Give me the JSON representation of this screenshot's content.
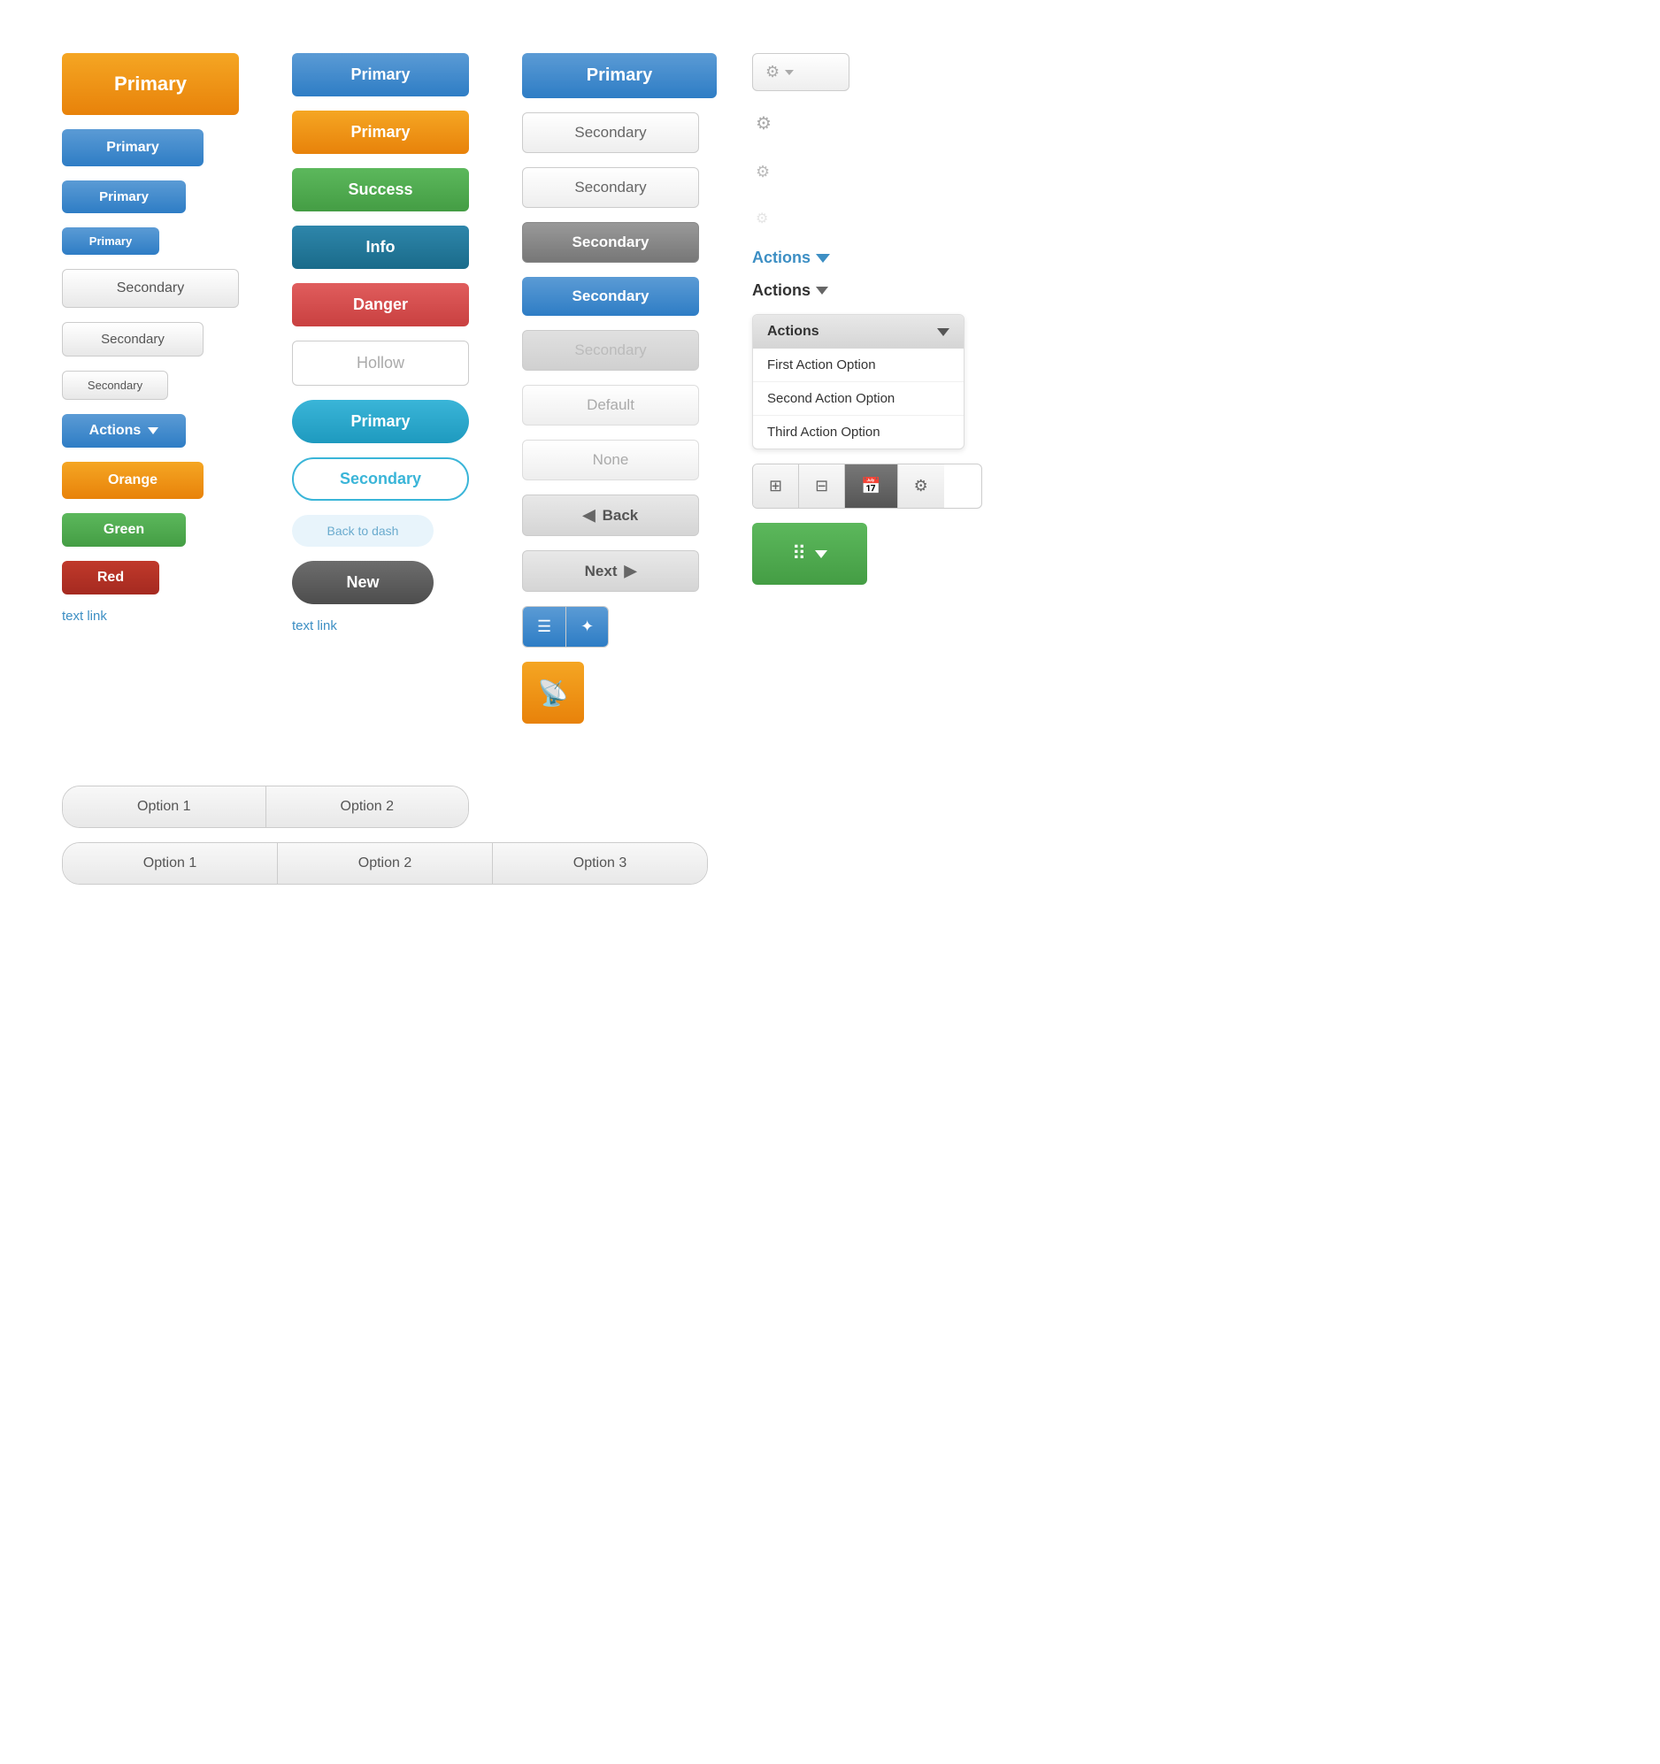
{
  "col1": {
    "buttons": [
      {
        "label": "Primary",
        "type": "primary-orange-lg"
      },
      {
        "label": "Primary",
        "type": "primary-blue"
      },
      {
        "label": "Primary",
        "type": "primary-blue-sm"
      },
      {
        "label": "Primary",
        "type": "primary-blue-xs"
      },
      {
        "label": "Secondary",
        "type": "secondary-lg"
      },
      {
        "label": "Secondary",
        "type": "secondary-md"
      },
      {
        "label": "Secondary",
        "type": "secondary-sm"
      },
      {
        "label": "Actions",
        "type": "actions-blue"
      },
      {
        "label": "Orange",
        "type": "orange"
      },
      {
        "label": "Green",
        "type": "green"
      },
      {
        "label": "Red",
        "type": "red"
      }
    ],
    "textLink": "text link"
  },
  "col2": {
    "buttons": [
      {
        "label": "Primary",
        "type": "col2-primary-blue"
      },
      {
        "label": "Primary",
        "type": "col2-primary-orange"
      },
      {
        "label": "Success",
        "type": "col2-success"
      },
      {
        "label": "Info",
        "type": "col2-info"
      },
      {
        "label": "Danger",
        "type": "col2-danger"
      },
      {
        "label": "Hollow",
        "type": "col2-hollow"
      },
      {
        "label": "Primary",
        "type": "col2-primary-pill"
      },
      {
        "label": "Secondary",
        "type": "col2-secondary-pill"
      },
      {
        "label": "Back to dash",
        "type": "col2-light-pill"
      },
      {
        "label": "New",
        "type": "col2-dark-pill"
      }
    ],
    "textLink": "text link"
  },
  "col3": {
    "buttons": [
      {
        "label": "Primary",
        "type": "col3-primary-blue"
      },
      {
        "label": "Secondary",
        "type": "col3-secondary"
      },
      {
        "label": "Secondary",
        "type": "col3-secondary-flat"
      },
      {
        "label": "Secondary",
        "type": "col3-secondary-dark"
      },
      {
        "label": "Secondary",
        "type": "col3-secondary-blue"
      },
      {
        "label": "Secondary",
        "type": "col3-secondary-disabled"
      },
      {
        "label": "Default",
        "type": "col3-default"
      },
      {
        "label": "None",
        "type": "col3-none"
      },
      {
        "label": "Back",
        "type": "col3-back"
      },
      {
        "label": "Next",
        "type": "col3-next"
      }
    ],
    "iconButtons": [
      "≡",
      "⋙"
    ],
    "rssLabel": "RSS"
  },
  "col4": {
    "gearButtons": [
      {
        "type": "gear-with-border"
      },
      {
        "type": "gear-plain-1"
      },
      {
        "type": "gear-plain-2"
      },
      {
        "type": "gear-plain-disabled"
      }
    ],
    "actionsBlueLabel": "Actions",
    "actionsDarkLabel": "Actions",
    "dropdown": {
      "headerLabel": "Actions",
      "items": [
        "First Action Option",
        "Second Action Option",
        "Third Action Option"
      ]
    },
    "toolbarButtons": [
      "grid",
      "columns",
      "calendar",
      "settings"
    ],
    "greenGridButton": "grid-dropdown"
  },
  "segmented2": {
    "options": [
      "Option 1",
      "Option 2"
    ]
  },
  "segmented3": {
    "options": [
      "Option 1",
      "Option 2",
      "Option 3"
    ]
  }
}
